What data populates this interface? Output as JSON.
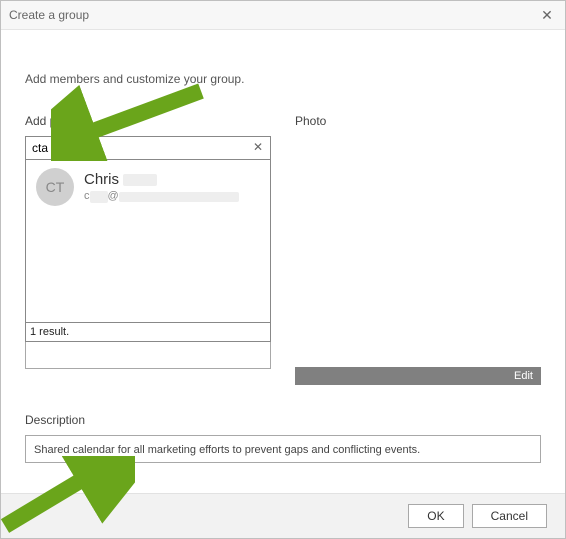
{
  "window": {
    "title": "Create a group"
  },
  "instruction": "Add members and customize your group.",
  "addPeople": {
    "label": "Add people",
    "searchValue": "cta",
    "results": [
      {
        "initials": "CT",
        "name": "Chris",
        "emailPrefix": "c",
        "emailAt": "@"
      }
    ],
    "resultsFooter": "1 result."
  },
  "photo": {
    "label": "Photo",
    "editLabel": "Edit"
  },
  "description": {
    "label": "Description",
    "value": "Shared calendar for all marketing efforts to prevent gaps and conflicting events."
  },
  "buttons": {
    "ok": "OK",
    "cancel": "Cancel"
  }
}
